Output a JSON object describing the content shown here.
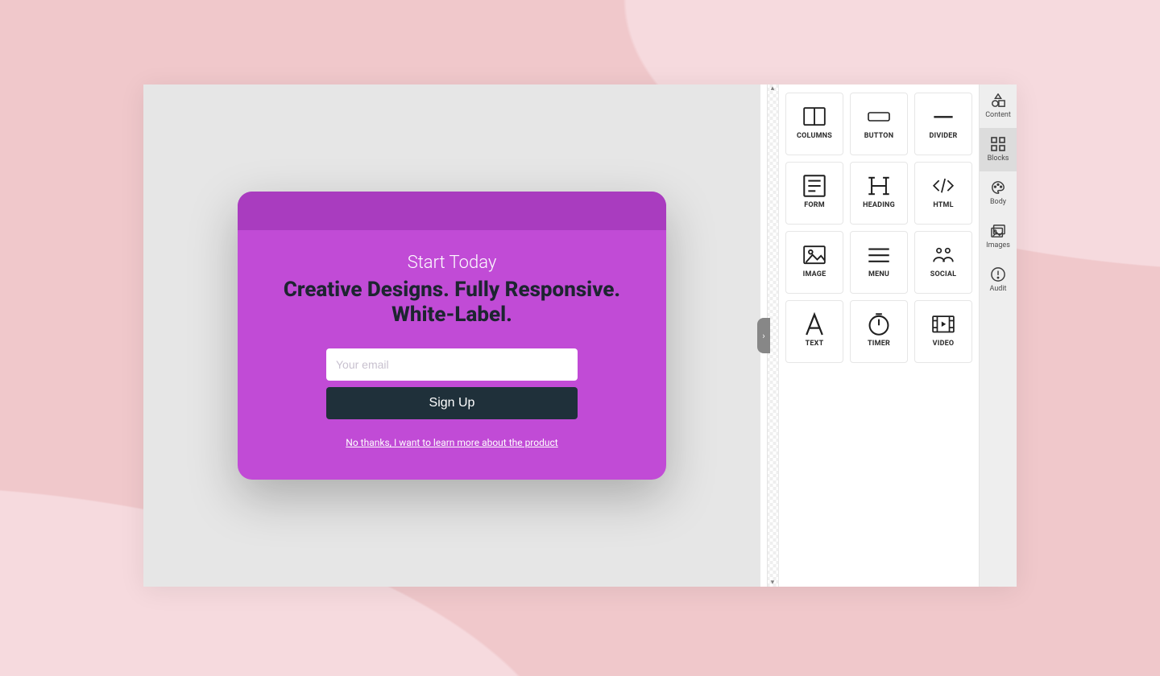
{
  "popup": {
    "subtitle": "Start Today",
    "title": "Creative Designs. Fully Responsive. White-Label.",
    "email_placeholder": "Your email",
    "signup_label": "Sign Up",
    "decline_label": "No thanks, I want to learn more about the product"
  },
  "blocks": [
    {
      "id": "columns",
      "label": "COLUMNS"
    },
    {
      "id": "button",
      "label": "BUTTON"
    },
    {
      "id": "divider",
      "label": "DIVIDER"
    },
    {
      "id": "form",
      "label": "FORM"
    },
    {
      "id": "heading",
      "label": "HEADING"
    },
    {
      "id": "html",
      "label": "HTML"
    },
    {
      "id": "image",
      "label": "IMAGE"
    },
    {
      "id": "menu",
      "label": "MENU"
    },
    {
      "id": "social",
      "label": "SOCIAL"
    },
    {
      "id": "text",
      "label": "TEXT"
    },
    {
      "id": "timer",
      "label": "TIMER"
    },
    {
      "id": "video",
      "label": "VIDEO"
    }
  ],
  "rail": [
    {
      "id": "content",
      "label": "Content",
      "active": false
    },
    {
      "id": "blocks",
      "label": "Blocks",
      "active": true
    },
    {
      "id": "body",
      "label": "Body",
      "active": false
    },
    {
      "id": "images",
      "label": "Images",
      "active": false
    },
    {
      "id": "audit",
      "label": "Audit",
      "active": false
    }
  ],
  "colors": {
    "popup_bg": "#c14bd6",
    "popup_header": "#a93cbf",
    "popup_button": "#1f303a",
    "canvas_bg": "#e6e6e6",
    "page_bg_light": "#f6dade",
    "page_bg_dark": "#f0c8cb"
  }
}
